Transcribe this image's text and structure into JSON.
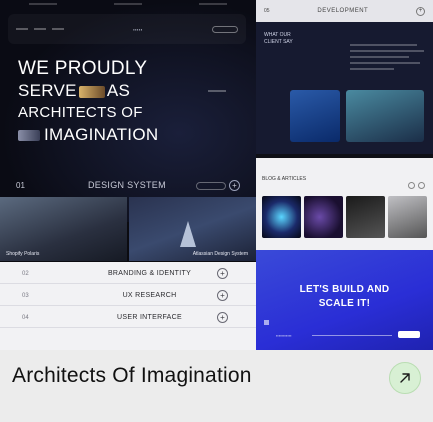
{
  "hero": {
    "line1": "WE PROUDLY",
    "line2_a": "SERVE",
    "line2_b": "AS",
    "line3": "ARCHITECTS OF",
    "line4": "IMAGINATION"
  },
  "design_system": {
    "num": "01",
    "title": "DESIGN SYSTEM",
    "plus": "+"
  },
  "portfolio_images": [
    {
      "caption": "Shopify Polaris"
    },
    {
      "caption": "Atlassian Design System"
    }
  ],
  "services": [
    {
      "num": "02",
      "label": "BRANDING & IDENTITY",
      "plus": "+"
    },
    {
      "num": "03",
      "label": "UX RESEARCH",
      "plus": "+"
    },
    {
      "num": "04",
      "label": "USER INTERFACE",
      "plus": "+"
    }
  ],
  "development": {
    "num": "05",
    "title": "DEVELOPMENT",
    "plus": "+"
  },
  "client_card": {
    "title": "WHAT OUR CLIENT SAY"
  },
  "blog_card": {
    "title": "BLOG & ARTICLES"
  },
  "cta": {
    "line1": "LET'S BUILD AND",
    "line2": "SCALE IT!"
  },
  "page_title": "Architects Of Imagination",
  "colors": {
    "accent_blue": "#2a2ed6",
    "arrow_bg": "#d8f0d4",
    "dark": "#0b0b10"
  },
  "icons": {
    "arrow": "arrow-up-right-icon"
  }
}
